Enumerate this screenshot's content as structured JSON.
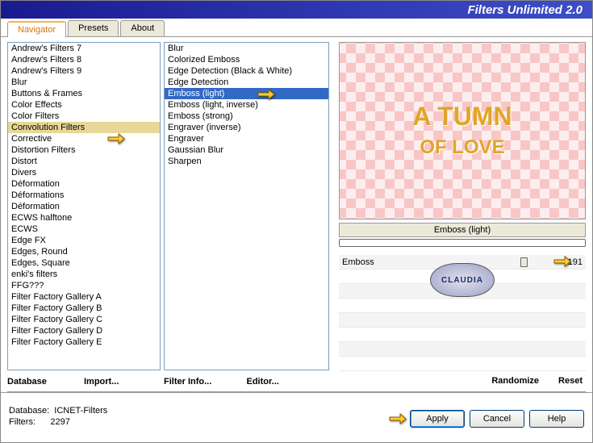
{
  "titlebar": "Filters Unlimited 2.0",
  "tabs": [
    "Navigator",
    "Presets",
    "About"
  ],
  "active_tab_index": 0,
  "left_list": [
    "Andrew's Filters 7",
    "Andrew's Filters 8",
    "Andrew's Filters 9",
    "Blur",
    "Buttons & Frames",
    "Color Effects",
    "Color Filters",
    "Convolution Filters",
    "Corrective",
    "Distortion Filters",
    "Distort",
    "Divers",
    "Déformation",
    "Déformations",
    "Déformation",
    "ECWS halftone",
    "ECWS",
    "Edge FX",
    "Edges, Round",
    "Edges, Square",
    "enki's filters",
    "FFG???",
    "Filter Factory Gallery A",
    "Filter Factory Gallery B",
    "Filter Factory Gallery C",
    "Filter Factory Gallery D",
    "Filter Factory Gallery E"
  ],
  "left_hover_index": 7,
  "mid_list": [
    "Blur",
    "Colorized Emboss",
    "Edge Detection (Black & White)",
    "Edge Detection",
    "Emboss (light)",
    "Emboss (light, inverse)",
    "Emboss (strong)",
    "Engraver (inverse)",
    "Engraver",
    "Gaussian Blur",
    "Sharpen"
  ],
  "mid_selected_index": 4,
  "left_buttons": {
    "database": "Database",
    "import": "Import..."
  },
  "mid_buttons": {
    "filter_info": "Filter Info...",
    "editor": "Editor..."
  },
  "preview_caption_top": "A TUMN",
  "preview_caption_bottom": "OF LOVE",
  "preview_title": "Emboss (light)",
  "param": {
    "label": "Emboss",
    "value": "191",
    "thumb_pct": 75
  },
  "right_buttons": {
    "randomize": "Randomize",
    "reset": "Reset"
  },
  "footer": {
    "db_label": "Database:",
    "db_value": "ICNET-Filters",
    "filters_label": "Filters:",
    "filters_value": "2297",
    "apply": "Apply",
    "cancel": "Cancel",
    "help": "Help"
  },
  "watermark": "CLAUDIA"
}
